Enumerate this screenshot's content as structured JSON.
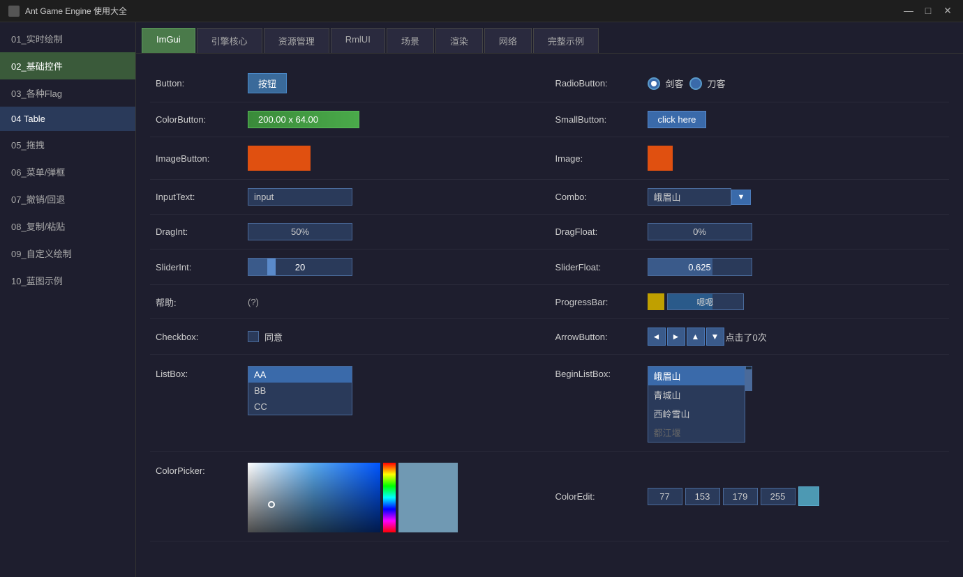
{
  "titleBar": {
    "title": "Ant Game Engine 使用大全",
    "controls": [
      "—",
      "□",
      "✕"
    ]
  },
  "tabs": [
    {
      "label": "ImGui",
      "active": true
    },
    {
      "label": "引擎核心"
    },
    {
      "label": "资源管理"
    },
    {
      "label": "RmlUI"
    },
    {
      "label": "场景"
    },
    {
      "label": "渲染"
    },
    {
      "label": "网络"
    },
    {
      "label": "完整示例"
    }
  ],
  "sidebar": {
    "items": [
      {
        "label": "01_实时绘制",
        "active": false
      },
      {
        "label": "02_基础控件",
        "active": true
      },
      {
        "label": "03_各种Flag",
        "active": false
      },
      {
        "label": "04 Table",
        "active": false
      },
      {
        "label": "05_拖拽",
        "active": false
      },
      {
        "label": "06_菜单/弹框",
        "active": false
      },
      {
        "label": "07_撤销/回退",
        "active": false
      },
      {
        "label": "08_复制/粘贴",
        "active": false
      },
      {
        "label": "09_自定义绘制",
        "active": false
      },
      {
        "label": "10_蓝图示例",
        "active": false
      }
    ]
  },
  "controls": {
    "button": {
      "label": "Button:",
      "btnText": "按钮"
    },
    "radioButton": {
      "label": "RadioButton:",
      "option1": "剑客",
      "option2": "刀客"
    },
    "colorButton": {
      "label": "ColorButton:",
      "value": "200.00 x 64.00"
    },
    "smallButton": {
      "label": "SmallButton:",
      "btnText": "click here"
    },
    "imageButton": {
      "label": "ImageButton:"
    },
    "image": {
      "label": "Image:"
    },
    "inputText": {
      "label": "InputText:",
      "value": "input"
    },
    "combo": {
      "label": "Combo:",
      "value": "峨眉山"
    },
    "dragInt": {
      "label": "DragInt:",
      "value": "50%"
    },
    "dragFloat": {
      "label": "DragFloat:",
      "value": "0%"
    },
    "sliderInt": {
      "label": "SliderInt:",
      "value": "20",
      "fillPct": 20
    },
    "sliderFloat": {
      "label": "SliderFloat:",
      "value": "0.625",
      "fillPct": 62.5
    },
    "help": {
      "label": "帮助:",
      "text": "(?)"
    },
    "progressBar": {
      "label": "ProgressBar:",
      "text": "嗯嗯"
    },
    "checkbox": {
      "label": "Checkbox:",
      "checkText": "同意"
    },
    "arrowButton": {
      "label": "ArrowButton:",
      "clickCount": "点击了0次"
    },
    "listBox": {
      "label": "ListBox:",
      "items": [
        "AA",
        "BB",
        "CC"
      ],
      "selected": 0
    },
    "beginListBox": {
      "label": "BeginListBox:",
      "items": [
        "峨眉山",
        "青城山",
        "西岭雪山",
        "都江堰"
      ],
      "selected": 0
    },
    "colorPicker": {
      "label": "ColorPicker:"
    },
    "colorEdit": {
      "label": "ColorEdit:",
      "r": "77",
      "g": "153",
      "b": "179",
      "a": "255"
    }
  }
}
